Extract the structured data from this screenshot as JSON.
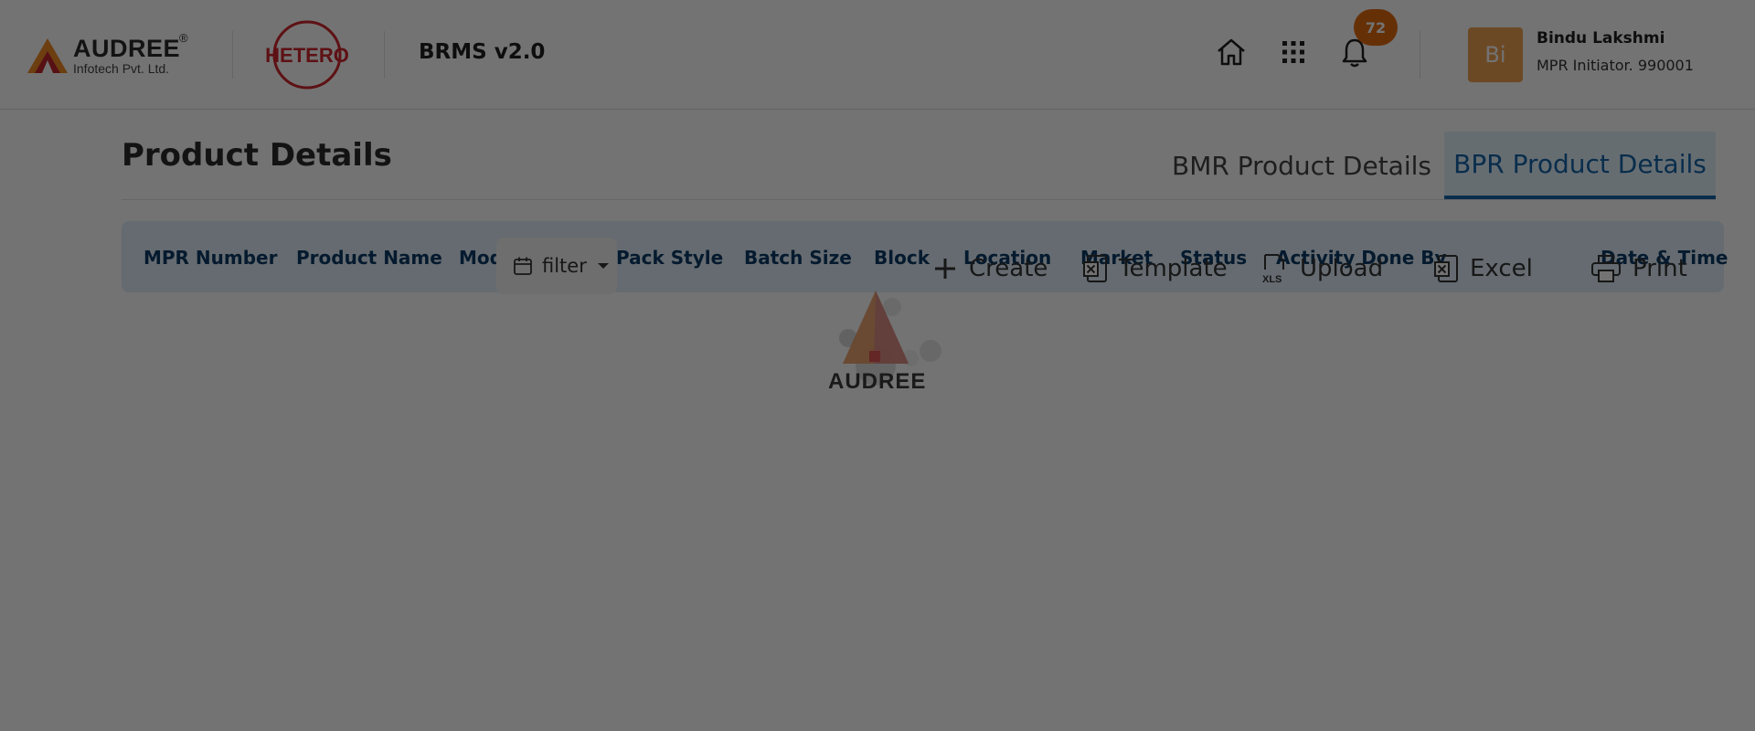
{
  "header": {
    "brand_name": "AUDREE",
    "brand_reg": "®",
    "brand_tagline": "Infotech Pvt. Ltd.",
    "client_logo_text": "HETERO",
    "app_version": "BRMS v2.0",
    "notifications_count": "72",
    "user": {
      "initials": "Bi",
      "name": "Bindu Lakshmi",
      "role": "MPR Initiator. 990001"
    },
    "icons": [
      "home-icon",
      "apps-grid-icon",
      "bell-icon"
    ]
  },
  "page": {
    "title": "Product Details",
    "tabs": [
      {
        "label": "BMR Product Details",
        "active": false
      },
      {
        "label": "BPR Product Details",
        "active": true
      }
    ]
  },
  "table": {
    "columns": [
      "MPR Number",
      "Product Name",
      "Mod",
      "Pack Style",
      "Batch Size",
      "Block",
      "Location",
      "Market",
      "Status",
      "Activity Done By",
      "Date & Time"
    ]
  },
  "toolbar": {
    "filter_label": "filter",
    "create_label": "Create",
    "template_label": "Template",
    "upload_label": "Upload",
    "excel_label": "Excel",
    "print_label": "Print"
  },
  "loader": {
    "text": "AUDREE"
  },
  "colors": {
    "accent": "#1565a8",
    "table_header_bg": "#dfeef9",
    "badge": "#e36a10",
    "avatar": "#f0a252",
    "overlay": "rgba(0,0,0,0.55)"
  }
}
